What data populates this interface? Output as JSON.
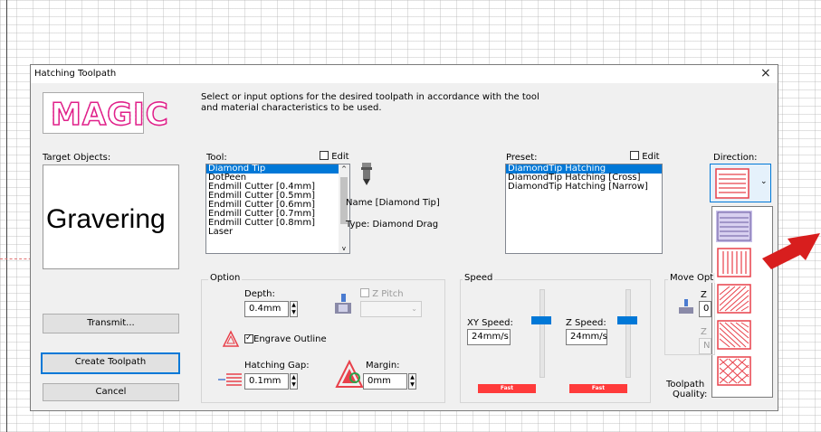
{
  "window": {
    "title": "Hatching Toolpath",
    "close_glyph": "×"
  },
  "logo_text": "MAGIC",
  "intro_text": "Select or input options for the desired toolpath in accordance with the tool and material characteristics to be used.",
  "target": {
    "label": "Target Objects:",
    "preview_text": "Gravering"
  },
  "buttons": {
    "transmit": "Transmit...",
    "create": "Create Toolpath",
    "cancel": "Cancel"
  },
  "tool": {
    "label": "Tool:",
    "edit_label": "Edit",
    "items": [
      "Diamond Tip",
      "DotPeen",
      "Endmill Cutter [0.4mm]",
      "Endmill Cutter [0.5mm]",
      "Endmill Cutter [0.6mm]",
      "Endmill Cutter [0.7mm]",
      "Endmill Cutter [0.8mm]",
      "Laser"
    ],
    "selected_index": 0,
    "name": "Name [Diamond Tip]",
    "type": "Type: Diamond Drag"
  },
  "preset": {
    "label": "Preset:",
    "edit_label": "Edit",
    "items": [
      "DiamondTip Hatching",
      "DiamondTip Hatching [Cross]",
      "DiamondTip Hatching [Narrow]"
    ],
    "selected_index": 0
  },
  "direction": {
    "label": "Direction:",
    "options": [
      "horizontal",
      "diagonal",
      "vertical",
      "diagonal-dense",
      "cross"
    ],
    "selected_index": 0
  },
  "option": {
    "group_label": "Option",
    "depth_label": "Depth:",
    "depth_value": "0.4mm",
    "zpitch_label": "Z Pitch",
    "engrave_outline_label": "Engrave Outline",
    "engrave_outline_checked": true,
    "hatch_gap_label": "Hatching Gap:",
    "hatch_gap_value": "0.1mm",
    "margin_label": "Margin:",
    "margin_value": "0mm"
  },
  "speed": {
    "group_label": "Speed",
    "xy_label": "XY Speed:",
    "xy_value": "24mm/s",
    "z_label": "Z Speed:",
    "z_value": "24mm/s",
    "fast_label": "Fast"
  },
  "move": {
    "group_label": "Move Opt",
    "z_label": "Z",
    "z_value": "0",
    "z2_label": "Z",
    "n_value": "N"
  },
  "quality": {
    "label_line1": "Toolpath",
    "label_line2": "Quality:"
  },
  "colors": {
    "accent": "#0078d7",
    "logo": "#e0208a",
    "hatch": "#e8404a",
    "arrow": "#d81e1e",
    "fast": "#ff3b3b"
  }
}
